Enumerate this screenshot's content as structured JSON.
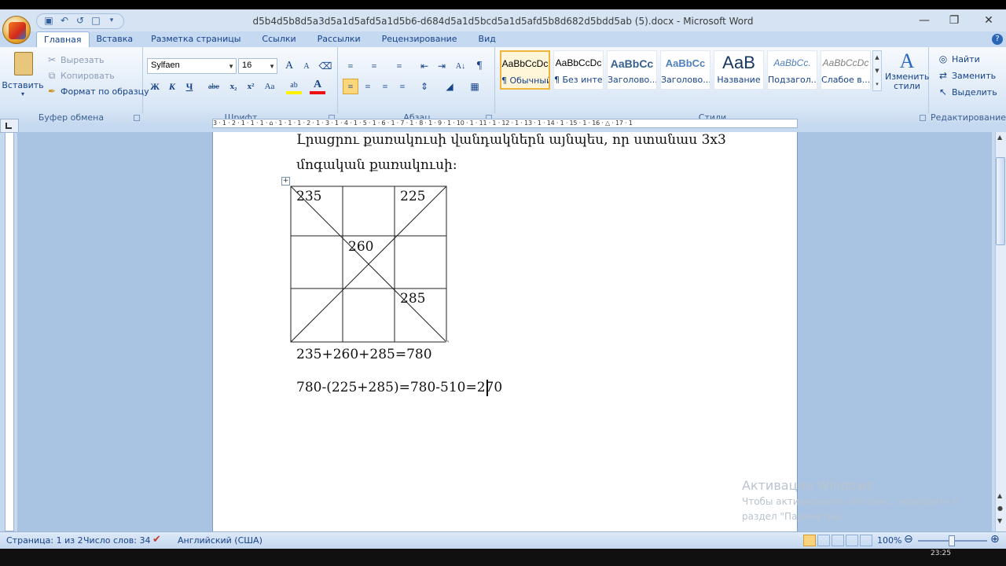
{
  "window": {
    "title": "d5b4d5b8d5a3d5a1d5afd5a1d5b6-d684d5a1d5bcd5a1d5afd5b8d682d5bdd5ab (5).docx - Microsoft Word",
    "minimize_glyph": "—",
    "restore_glyph": "❐",
    "close_glyph": "✕"
  },
  "quick_access": [
    "save-icon",
    "undo-icon",
    "redo-icon",
    "new-document-icon",
    "customize-icon"
  ],
  "tabs": [
    "Главная",
    "Вставка",
    "Разметка страницы",
    "Ссылки",
    "Рассылки",
    "Рецензирование",
    "Вид"
  ],
  "active_tab": "Главная",
  "help_glyph": "?",
  "clipboard": {
    "paste": "Вставить",
    "cut": "Вырезать",
    "copy": "Копировать",
    "format_painter": "Формат по образцу",
    "label": "Буфер обмена"
  },
  "font": {
    "family": "Sylfaen",
    "size": "16",
    "grow": "A",
    "shrink": "A",
    "bold": "Ж",
    "italic": "К",
    "underline": "Ч",
    "strike": "abe",
    "subscript": "x₂",
    "superscript": "x²",
    "change_case": "Aa",
    "highlight": "ab",
    "color": "A",
    "label": "Шрифт"
  },
  "paragraph": {
    "sort": "А↓",
    "marks": "¶",
    "label": "Абзац"
  },
  "styles": {
    "items": [
      {
        "preview": "AaBbCcDc",
        "name": "¶ Обычный",
        "selected": true
      },
      {
        "preview": "AaBbCcDc",
        "name": "¶ Без инте...",
        "selected": false
      },
      {
        "preview": "AaBbCc",
        "name": "Заголово...",
        "selected": false
      },
      {
        "preview": "AaBbCc",
        "name": "Заголово...",
        "selected": false
      },
      {
        "preview": "АаВ",
        "name": "Название",
        "selected": false
      },
      {
        "preview": "AaBbCc.",
        "name": "Подзагол...",
        "selected": false
      },
      {
        "preview": "AaBbCcDc",
        "name": "Слабое в...",
        "selected": false
      }
    ],
    "change_styles": "Изменить стили",
    "label": "Стили"
  },
  "editing": {
    "find": "Найти",
    "replace": "Заменить",
    "select": "Выделить",
    "label": "Редактирование"
  },
  "ruler_text": "3 · 1 · 2 · 1 · 1 · 1 · ⌂ · 1 · 1 · 1 · 2 · 1 · 3 · 1 · 4 · 1 · 5 · 1 · 6 · 1 · 7 · 1 · 8 · 1 · 9 · 1 · 10 · 1 · 11 · 1 · 12 · 1 · 13 · 1 · 14 · 1 · 15 · 1 · 16 · △ · 17 · 1",
  "document": {
    "line1": "Լրացրու քառակուսի վանդակներն այնպես, որ ստանաս 3x3",
    "line2": "մոգական քառակուսի:",
    "grid": [
      [
        "235",
        "",
        "225"
      ],
      [
        "",
        "260",
        ""
      ],
      [
        "",
        "",
        "285"
      ]
    ],
    "eq1": "235+260+285=780",
    "eq2": "780-(225+285)=780-510=270"
  },
  "activation": {
    "title": "Активация Windows",
    "line1": "Чтобы активировать Windows, перейдите в",
    "line2": "раздел \"Параметры\"."
  },
  "status": {
    "page": "Страница: 1 из 2",
    "words": "Число слов: 34",
    "language": "Английский (США)",
    "zoom": "100%",
    "zoom_out": "⊖",
    "zoom_in": "⊕",
    "clock": "23:25"
  }
}
